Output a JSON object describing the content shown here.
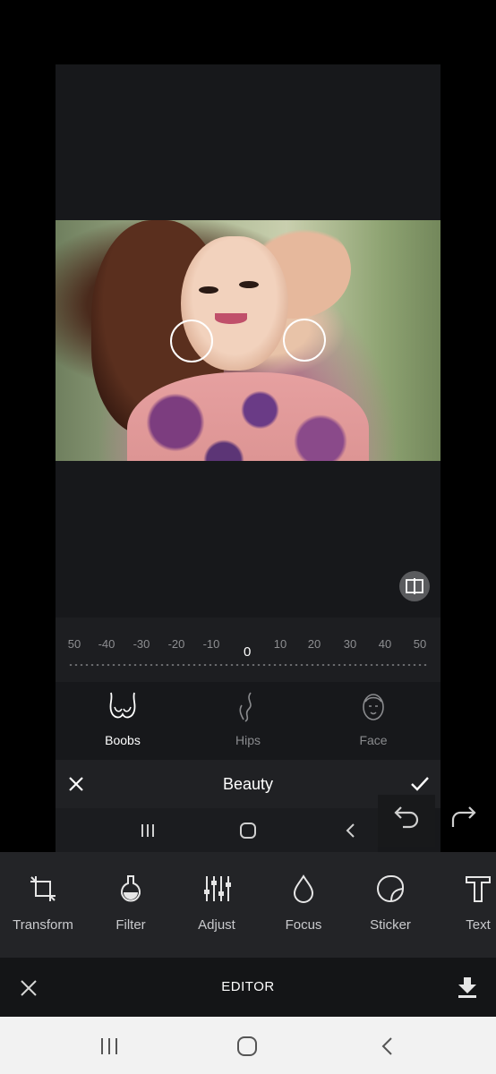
{
  "ruler": {
    "ticks": [
      "50",
      "-40",
      "-30",
      "-20",
      "-10",
      "10",
      "20",
      "30",
      "40",
      "50"
    ],
    "current_value": "0"
  },
  "beauty_categories": [
    {
      "label": "Boobs",
      "icon": "boobs-icon",
      "selected": true
    },
    {
      "label": "Hips",
      "icon": "hips-icon",
      "selected": false
    },
    {
      "label": "Face",
      "icon": "face-icon",
      "selected": false
    }
  ],
  "beauty_bar": {
    "title": "Beauty"
  },
  "tools": [
    {
      "label": "Transform",
      "icon": "crop-icon"
    },
    {
      "label": "Filter",
      "icon": "flask-icon"
    },
    {
      "label": "Adjust",
      "icon": "sliders-icon"
    },
    {
      "label": "Focus",
      "icon": "drop-icon"
    },
    {
      "label": "Sticker",
      "icon": "sticker-icon"
    },
    {
      "label": "Text",
      "icon": "text-icon"
    }
  ],
  "editor": {
    "title": "EDITOR"
  },
  "colors": {
    "selected": "#ffffff",
    "unselected": "#8a8b8e",
    "toolbar": "#232427"
  }
}
